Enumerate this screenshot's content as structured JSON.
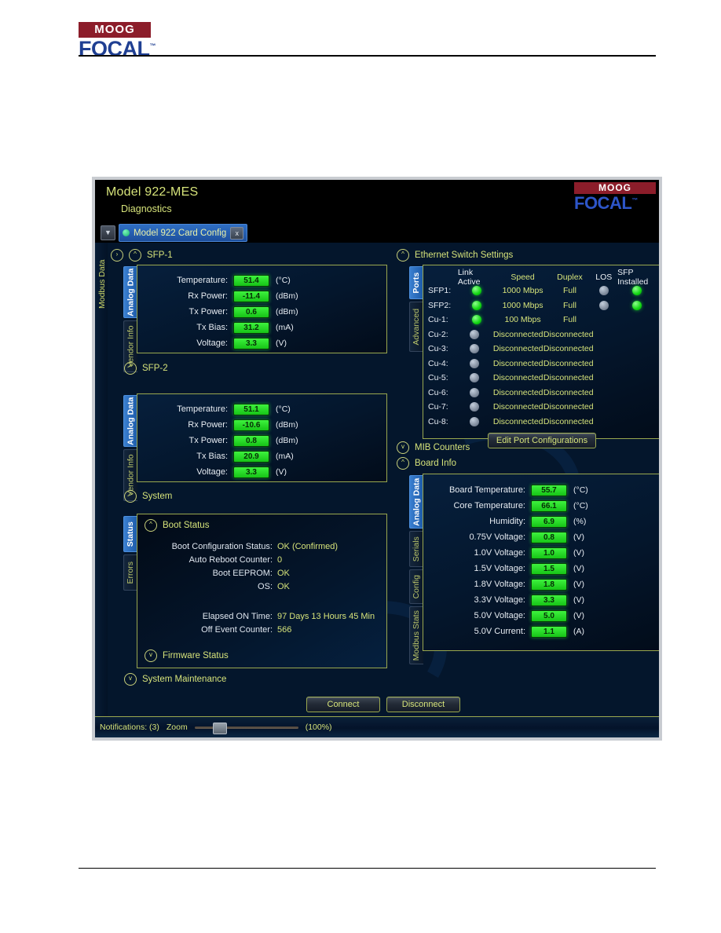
{
  "document": {
    "logo": {
      "moog": "MOOG",
      "focal": "FOCAL",
      "tm": "™"
    }
  },
  "app": {
    "title": "Model 922-MES",
    "subtitle": "Diagnostics",
    "logo": {
      "moog": "MOOG",
      "focal": "FOCAL",
      "tm": "™"
    },
    "tab": {
      "label": "Model 922 Card Config",
      "close": "x",
      "pin": "▼"
    },
    "left_rail_label": "Modbus Data"
  },
  "sections": {
    "sfp1": {
      "title": "SFP-1",
      "chevron": "^"
    },
    "sfp2": {
      "title": "SFP-2",
      "chevron": "^"
    },
    "system": {
      "title": "System",
      "chevron": "^"
    },
    "system_maintenance": {
      "title": "System Maintenance",
      "chevron": "v"
    },
    "ethernet": {
      "title": "Ethernet Switch Settings",
      "chevron": "^"
    },
    "mib": {
      "title": "MIB Counters",
      "chevron": "v"
    },
    "board_info": {
      "title": "Board Info",
      "chevron": "^"
    },
    "boot_status": {
      "title": "Boot Status",
      "chevron": "^"
    },
    "firmware_status": {
      "title": "Firmware Status",
      "chevron": "v"
    }
  },
  "sfp1": {
    "tabs": [
      {
        "label": "Analog Data",
        "active": true
      },
      {
        "label": "Vendor Info",
        "active": false
      }
    ],
    "rows": [
      {
        "label": "Temperature:",
        "value": "51.4",
        "unit": "(°C)"
      },
      {
        "label": "Rx Power:",
        "value": "-11.4",
        "unit": "(dBm)"
      },
      {
        "label": "Tx Power:",
        "value": "0.6",
        "unit": "(dBm)"
      },
      {
        "label": "Tx Bias:",
        "value": "31.2",
        "unit": "(mA)"
      },
      {
        "label": "Voltage:",
        "value": "3.3",
        "unit": "(V)"
      }
    ]
  },
  "sfp2": {
    "tabs": [
      {
        "label": "Analog Data",
        "active": true
      },
      {
        "label": "Vendor Info",
        "active": false
      }
    ],
    "rows": [
      {
        "label": "Temperature:",
        "value": "51.1",
        "unit": "(°C)"
      },
      {
        "label": "Rx Power:",
        "value": "-10.6",
        "unit": "(dBm)"
      },
      {
        "label": "Tx Power:",
        "value": "0.8",
        "unit": "(dBm)"
      },
      {
        "label": "Tx Bias:",
        "value": "20.9",
        "unit": "(mA)"
      },
      {
        "label": "Voltage:",
        "value": "3.3",
        "unit": "(V)"
      }
    ]
  },
  "system": {
    "tabs": [
      {
        "label": "Status",
        "active": true
      },
      {
        "label": "Errors",
        "active": false
      }
    ],
    "boot_rows": [
      {
        "key": "Boot Configuration Status:",
        "value": "OK (Confirmed)"
      },
      {
        "key": "Auto Reboot Counter:",
        "value": "0"
      },
      {
        "key": "Boot EEPROM:",
        "value": "OK"
      },
      {
        "key": "OS:",
        "value": "OK"
      }
    ],
    "time_rows": [
      {
        "key": "Elapsed ON Time:",
        "value": "97 Days 13 Hours 45 Min"
      },
      {
        "key": "Off Event Counter:",
        "value": "566"
      }
    ]
  },
  "ethernet": {
    "tabs": [
      {
        "label": "Ports",
        "active": true
      },
      {
        "label": "Advanced",
        "active": false
      }
    ],
    "headers": [
      "",
      "Link Active",
      "Speed",
      "Duplex",
      "LOS",
      "SFP Installed"
    ],
    "rows": [
      {
        "port": "SFP1:",
        "link": "on",
        "speed": "1000 Mbps",
        "duplex": "Full",
        "los": "off",
        "sfp": "on"
      },
      {
        "port": "SFP2:",
        "link": "on",
        "speed": "1000 Mbps",
        "duplex": "Full",
        "los": "off",
        "sfp": "on"
      },
      {
        "port": "Cu-1:",
        "link": "on",
        "speed": "100 Mbps",
        "duplex": "Full",
        "los": "",
        "sfp": ""
      },
      {
        "port": "Cu-2:",
        "link": "off",
        "speed": "Disconnected",
        "duplex": "Disconnected",
        "los": "",
        "sfp": ""
      },
      {
        "port": "Cu-3:",
        "link": "off",
        "speed": "Disconnected",
        "duplex": "Disconnected",
        "los": "",
        "sfp": ""
      },
      {
        "port": "Cu-4:",
        "link": "off",
        "speed": "Disconnected",
        "duplex": "Disconnected",
        "los": "",
        "sfp": ""
      },
      {
        "port": "Cu-5:",
        "link": "off",
        "speed": "Disconnected",
        "duplex": "Disconnected",
        "los": "",
        "sfp": ""
      },
      {
        "port": "Cu-6:",
        "link": "off",
        "speed": "Disconnected",
        "duplex": "Disconnected",
        "los": "",
        "sfp": ""
      },
      {
        "port": "Cu-7:",
        "link": "off",
        "speed": "Disconnected",
        "duplex": "Disconnected",
        "los": "",
        "sfp": ""
      },
      {
        "port": "Cu-8:",
        "link": "off",
        "speed": "Disconnected",
        "duplex": "Disconnected",
        "los": "",
        "sfp": ""
      }
    ],
    "edit_button": "Edit Port Configurations"
  },
  "board_info": {
    "tabs": [
      {
        "label": "Analog Data",
        "active": true
      },
      {
        "label": "Serials",
        "active": false
      },
      {
        "label": "Config",
        "active": false
      },
      {
        "label": "Modbus Stats",
        "active": false
      }
    ],
    "rows": [
      {
        "label": "Board Temperature:",
        "value": "55.7",
        "unit": "(°C)"
      },
      {
        "label": "Core Temperature:",
        "value": "66.1",
        "unit": "(°C)"
      },
      {
        "label": "Humidity:",
        "value": "6.9",
        "unit": "(%)"
      },
      {
        "label": "0.75V Voltage:",
        "value": "0.8",
        "unit": "(V)"
      },
      {
        "label": "1.0V Voltage:",
        "value": "1.0",
        "unit": "(V)"
      },
      {
        "label": "1.5V Voltage:",
        "value": "1.5",
        "unit": "(V)"
      },
      {
        "label": "1.8V Voltage:",
        "value": "1.8",
        "unit": "(V)"
      },
      {
        "label": "3.3V Voltage:",
        "value": "3.3",
        "unit": "(V)"
      },
      {
        "label": "5.0V Voltage:",
        "value": "5.0",
        "unit": "(V)"
      },
      {
        "label": "5.0V Current:",
        "value": "1.1",
        "unit": "(A)"
      }
    ]
  },
  "footer": {
    "connect": "Connect",
    "disconnect": "Disconnect"
  },
  "statusbar": {
    "notifications": "Notifications: (3)",
    "zoom_label": "Zoom",
    "zoom_value": "(100%)"
  },
  "colors": {
    "accent_yellow": "#d6e37a",
    "panel_border": "#9aa84f",
    "led_on": "#17d417",
    "led_off": "#7f8b9c",
    "tab_active": "#2f6fc4",
    "brand_red": "#8c1d2a",
    "brand_blue": "#1f3f92",
    "window_bg": "#04162c"
  }
}
